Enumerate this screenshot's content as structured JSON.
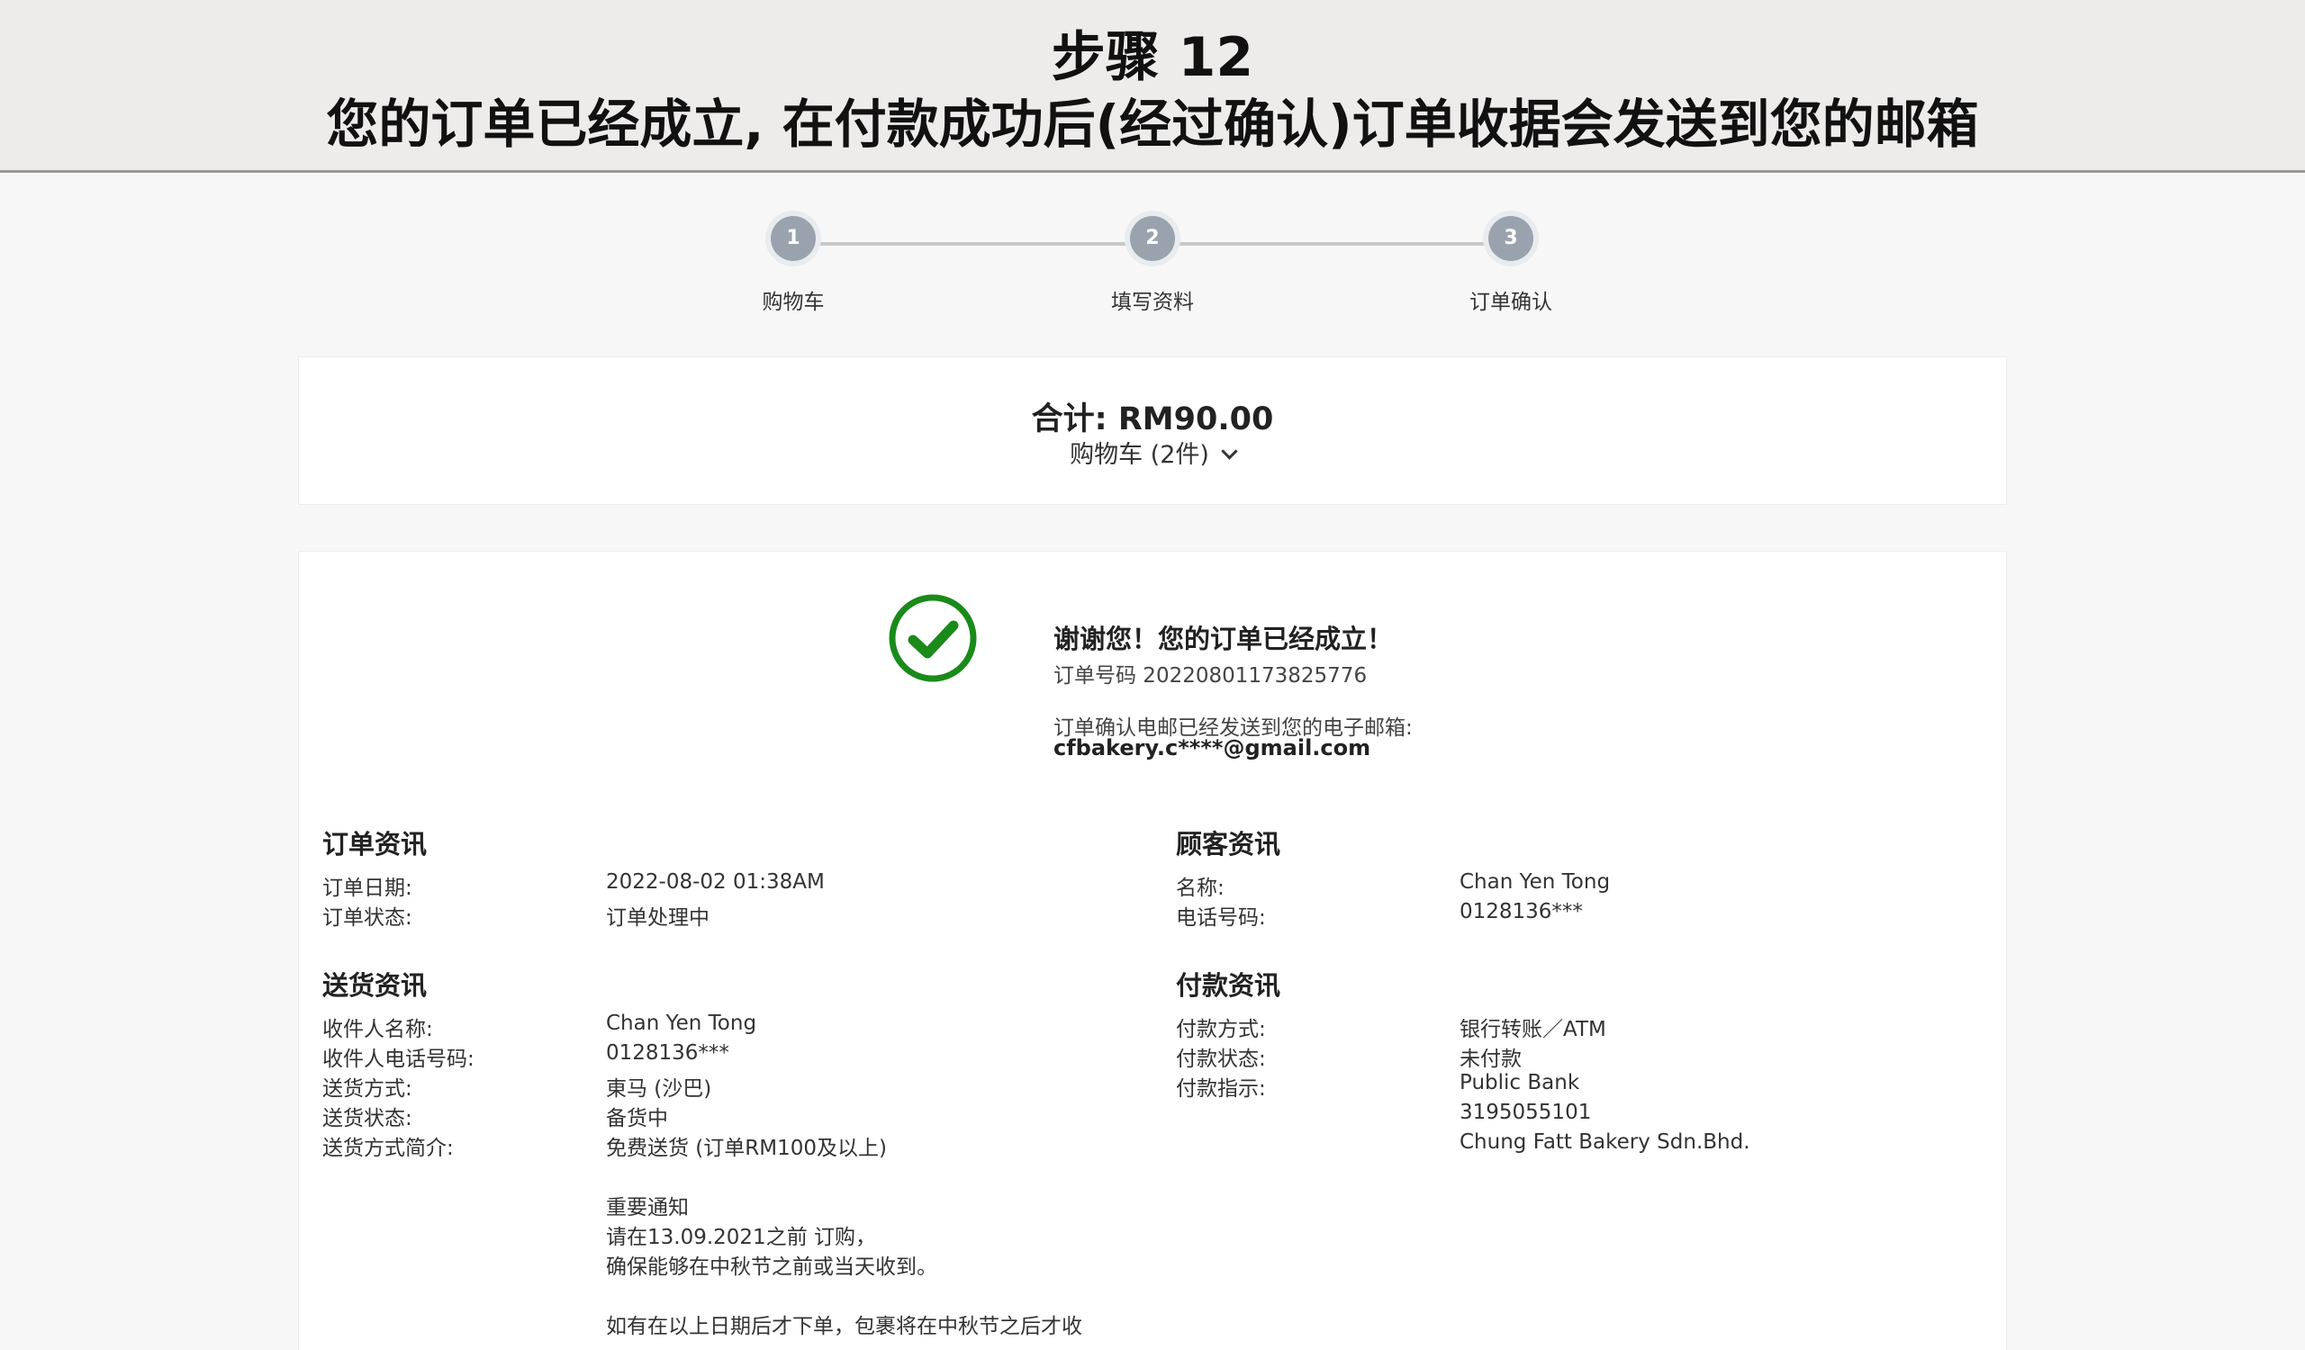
{
  "banner": {
    "step": "步骤 12",
    "subtitle": "您的订单已经成立, 在付款成功后(经过确认)订单收据会发送到您的邮箱"
  },
  "stepper": {
    "steps": [
      {
        "number": "1",
        "label": "购物车"
      },
      {
        "number": "2",
        "label": "填写资料"
      },
      {
        "number": "3",
        "label": "订单确认"
      }
    ]
  },
  "summary": {
    "total": "合计: RM90.00",
    "cart_toggle": "购物车 (2件)"
  },
  "confirmation": {
    "thanks": "谢谢您！您的订单已经成立！",
    "order_number": "订单号码 20220801173825776",
    "email_note": "订单确认电邮已经发送到您的电子邮箱:",
    "email": "cfbakery.c****@gmail.com",
    "check_icon": "check-circle-icon",
    "check_color": "#1a8a1a"
  },
  "order_info": {
    "title": "订单资讯",
    "rows": [
      {
        "label": "订单日期:",
        "value": "2022-08-02 01:38AM"
      },
      {
        "label": "订单状态:",
        "value": "订单处理中"
      }
    ]
  },
  "customer_info": {
    "title": "顾客资讯",
    "rows": [
      {
        "label": "名称:",
        "value": "Chan Yen Tong"
      },
      {
        "label": "电话号码:",
        "value": "0128136***"
      }
    ]
  },
  "delivery_info": {
    "title": "送货资讯",
    "rows": [
      {
        "label": "收件人名称:",
        "value": "Chan Yen Tong"
      },
      {
        "label": "收件人电话号码:",
        "value": "0128136***"
      },
      {
        "label": "送货方式:",
        "value": "東马 (沙巴)"
      },
      {
        "label": "送货状态:",
        "value": "备货中"
      },
      {
        "label": "送货方式简介:",
        "value": "免费送货 (订单RM100及以上)"
      }
    ],
    "notice": {
      "heading": "重要通知",
      "line1": "请在13.09.2021之前 订购，",
      "line2": "确保能够在中秋节之前或当天收到。",
      "line3": "如有在以上日期后才下单，包裹将在中秋节之后才收"
    }
  },
  "payment_info": {
    "title": "付款资讯",
    "rows": [
      {
        "label": "付款方式:",
        "value": "银行转账／ATM"
      },
      {
        "label": "付款状态:",
        "value": "未付款"
      },
      {
        "label": "付款指示:",
        "value": "Public Bank"
      }
    ],
    "instructions_extra": [
      "3195055101",
      "Chung Fatt Bakery Sdn.Bhd."
    ]
  }
}
